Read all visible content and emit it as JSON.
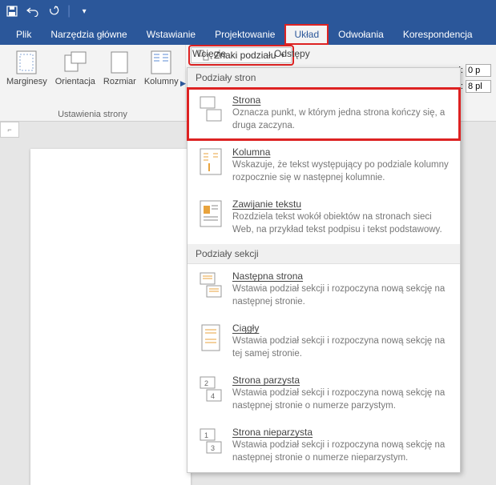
{
  "tabs": {
    "file": "Plik",
    "home": "Narzędzia główne",
    "insert": "Wstawianie",
    "design": "Projektowanie",
    "layout": "Układ",
    "references": "Odwołania",
    "mailings": "Korespondencja"
  },
  "ribbon": {
    "margins": "Marginesy",
    "orientation": "Orientacja",
    "size": "Rozmiar",
    "columns": "Kolumny",
    "page_setup_group": "Ustawienia strony",
    "breaks_button": "Znaki podziału",
    "indent_label": "Wcięcie",
    "spacing_label": "Odstępy",
    "spin_before_label": "ej:",
    "spin_before_value": "0 p",
    "spin_after_label": "ej:",
    "spin_after_value": "8 pl"
  },
  "menu": {
    "section1_header": "Podziały stron",
    "items1": [
      {
        "title": "Strona",
        "desc": "Oznacza punkt, w którym jedna strona kończy się, a druga zaczyna."
      },
      {
        "title": "Kolumna",
        "desc": "Wskazuje, że tekst występujący po podziale kolumny rozpocznie się w następnej kolumnie."
      },
      {
        "title": "Zawijanie tekstu",
        "desc": "Rozdziela tekst wokół obiektów na stronach sieci Web, na przykład tekst podpisu i tekst podstawowy."
      }
    ],
    "section2_header": "Podziały sekcji",
    "items2": [
      {
        "title": "Następna strona",
        "desc": "Wstawia podział sekcji i rozpoczyna nową sekcję na następnej stronie."
      },
      {
        "title": "Ciągły",
        "desc": "Wstawia podział sekcji i rozpoczyna nową sekcję na tej samej stronie."
      },
      {
        "title": "Strona parzysta",
        "desc": "Wstawia podział sekcji i rozpoczyna nową sekcję na następnej stronie o numerze parzystym."
      },
      {
        "title": "Strona nieparzysta",
        "desc": "Wstawia podział sekcji i rozpoczyna nową sekcję na następnej stronie o numerze nieparzystym."
      }
    ]
  }
}
